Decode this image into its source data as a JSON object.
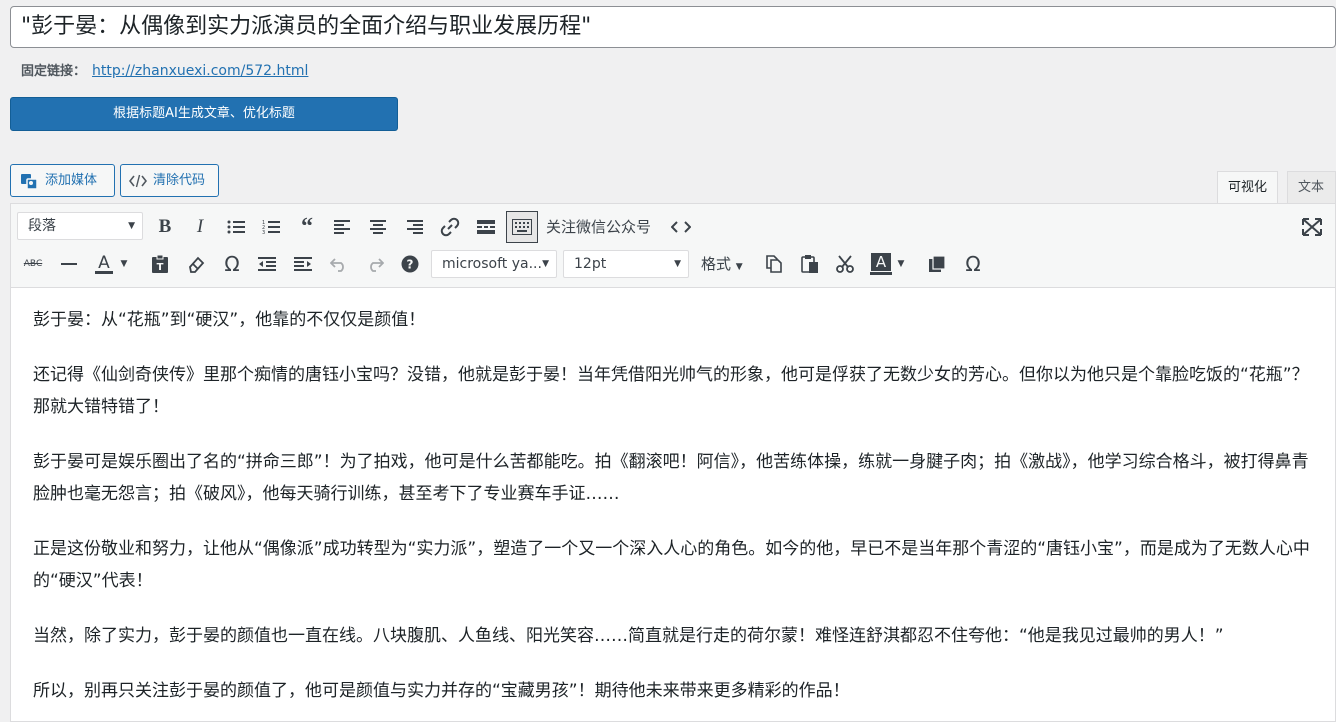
{
  "post": {
    "title": "\"彭于晏：从偶像到实力派演员的全面介绍与职业发展历程\"",
    "permalink_label": "固定链接：",
    "permalink_url": "http://zhanxuexi.com/572.html"
  },
  "ai_button": "根据标题AI生成文章、优化标题",
  "media_buttons": {
    "add_media": "添加媒体",
    "clear_code": "清除代码"
  },
  "editor_tabs": {
    "visual": "可视化",
    "text": "文本"
  },
  "toolbar": {
    "format_select": "段落",
    "wechat_label": "关注微信公众号",
    "font_family": "microsoft ya...",
    "font_size": "12pt",
    "formats_label": "格式"
  },
  "content": {
    "paragraphs": [
      "彭于晏：从“花瓶”到“硬汉”，他靠的不仅仅是颜值！",
      "还记得《仙剑奇侠传》里那个痴情的唐钰小宝吗？没错，他就是彭于晏！当年凭借阳光帅气的形象，他可是俘获了无数少女的芳心。但你以为他只是个靠脸吃饭的“花瓶”？那就大错特错了！",
      "彭于晏可是娱乐圈出了名的“拼命三郎”！为了拍戏，他可是什么苦都能吃。拍《翻滚吧！阿信》，他苦练体操，练就一身腱子肉；拍《激战》，他学习综合格斗，被打得鼻青脸肿也毫无怨言；拍《破风》，他每天骑行训练，甚至考下了专业赛车手证……",
      "正是这份敬业和努力，让他从“偶像派”成功转型为“实力派”，塑造了一个又一个深入人心的角色。如今的他，早已不是当年那个青涩的“唐钰小宝”，而是成为了无数人心中的“硬汉”代表！",
      "当然，除了实力，彭于晏的颜值也一直在线。八块腹肌、人鱼线、阳光笑容……简直就是行走的荷尔蒙！难怪连舒淇都忍不住夸他：“他是我见过最帅的男人！”",
      "所以，别再只关注彭于晏的颜值了，他可是颜值与实力并存的“宝藏男孩”！期待他未来带来更多精彩的作品！"
    ]
  }
}
